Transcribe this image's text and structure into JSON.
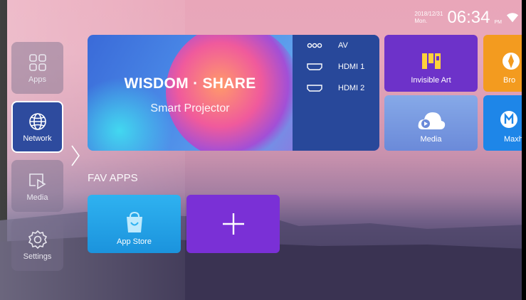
{
  "status": {
    "date": "2018/12/31",
    "weekday": "Mon.",
    "time": "06:34",
    "ampm": "PM",
    "wifi_icon": "wifi-icon"
  },
  "sidebar": {
    "items": [
      {
        "label": "Apps",
        "icon": "apps-grid-icon"
      },
      {
        "label": "Network",
        "icon": "globe-icon"
      },
      {
        "label": "Media",
        "icon": "media-play-icon"
      },
      {
        "label": "Settings",
        "icon": "gear-icon"
      }
    ]
  },
  "hero": {
    "title": "WISDOM · SHARE",
    "subtitle": "Smart Projector",
    "inputs": [
      {
        "label": "AV",
        "icon": "av-icon"
      },
      {
        "label": "HDMI 1",
        "icon": "hdmi-icon"
      },
      {
        "label": "HDMI 2",
        "icon": "hdmi-icon"
      }
    ]
  },
  "tiles": {
    "invisible_art": "Invisible Art",
    "browser": "Bro",
    "media": "Media",
    "maxhub": "Maxhu"
  },
  "fav": {
    "title": "FAV APPS",
    "app_store": "App Store",
    "add_icon": "plus-icon"
  },
  "colors": {
    "accent": "#2e4b9e",
    "inputs_panel": "#28489a",
    "art_tile": "#6d32c9",
    "browser_tile": "#f39b1f",
    "maxhub_tile": "#1e86e8",
    "app_store_tile": "#2fb2f0",
    "add_tile": "#7a30d6"
  }
}
